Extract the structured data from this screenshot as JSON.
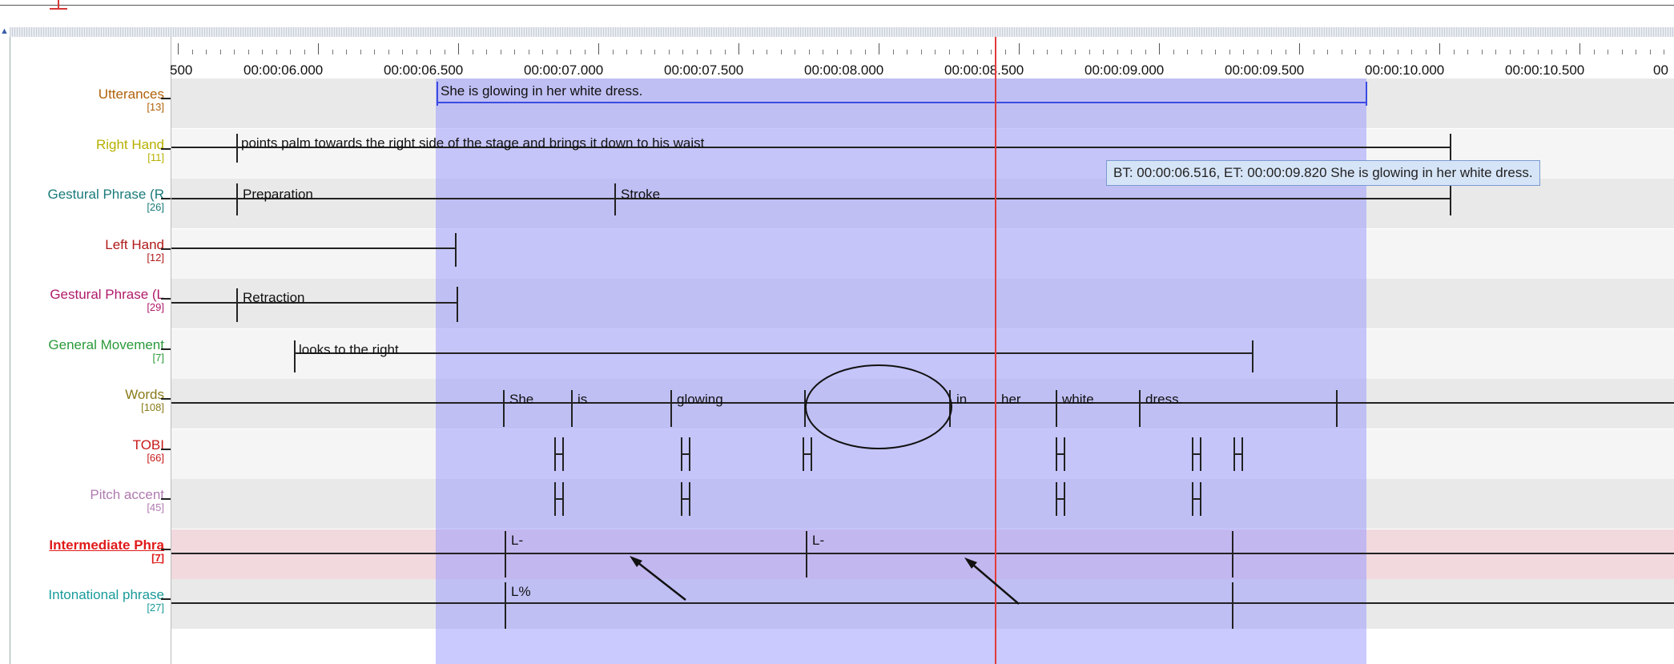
{
  "ruler": {
    "first_label": "500",
    "labels": [
      "00:00:06.000",
      "00:00:06.500",
      "00:00:07.000",
      "00:00:07.500",
      "00:00:08.000",
      "00:00:08.500",
      "00:00:09.000",
      "00:00:09.500",
      "00:00:10.000",
      "00:00:10.500",
      "00"
    ]
  },
  "tiers": [
    {
      "name": "Utterances",
      "count": "[13]",
      "color": "#b0620a"
    },
    {
      "name": "Right Hand",
      "count": "[11]",
      "color": "#b7b000"
    },
    {
      "name": "Gestural Phrase (R",
      "count": "[26]",
      "color": "#1a7a7a"
    },
    {
      "name": "Left Hand",
      "count": "[12]",
      "color": "#b01a1a"
    },
    {
      "name": "Gestural Phrase (L",
      "count": "[29]",
      "color": "#b01a6a"
    },
    {
      "name": "General Movement",
      "count": "[7]",
      "color": "#2a9a3a"
    },
    {
      "name": "Words",
      "count": "[108]",
      "color": "#8a7a1a"
    },
    {
      "name": "TOBI",
      "count": "[66]",
      "color": "#c81a1a"
    },
    {
      "name": "Pitch accent",
      "count": "[45]",
      "color": "#b07ab0"
    },
    {
      "name": "Intermediate Phra",
      "count": "[7]",
      "color": "#e01a1a"
    },
    {
      "name": "Intonational phrase",
      "count": "[27]",
      "color": "#1a9a9a"
    }
  ],
  "annotations": {
    "utterance": "She is glowing in her white dress.",
    "right_hand": "points palm towards the right side of the stage and brings it down to his waist",
    "gesture_r_1": "Preparation",
    "gesture_r_2": "Stroke",
    "gesture_l_1": "Retraction",
    "general_movement": "looks to the right",
    "words": [
      "She",
      "is",
      "glowing",
      "in",
      "her",
      "white",
      "dress."
    ],
    "intermediate_1": "L-",
    "intermediate_2": "L-",
    "intonational_1": "L%"
  },
  "tooltip": "BT: 00:00:06.516, ET: 00:00:09.820 She is glowing in her white dress.",
  "colors": {
    "selection": "#9696ff",
    "cursor": "#e03c3c",
    "active_tier_row": "#f1d9de"
  }
}
